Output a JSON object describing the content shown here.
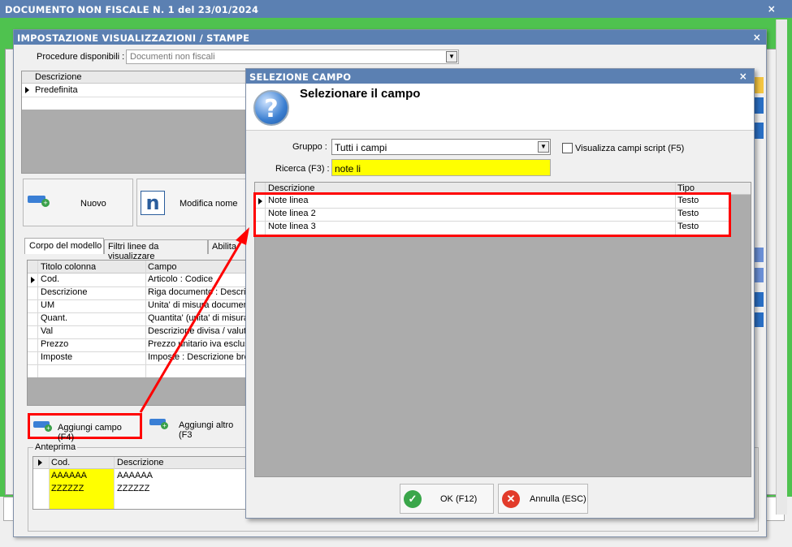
{
  "main_window": {
    "title": "DOCUMENTO NON FISCALE N. 1 del 23/01/2024",
    "close": "×"
  },
  "settings_dialog": {
    "title": "IMPOSTAZIONE VISUALIZZAZIONI / STAMPE",
    "close": "×",
    "procedure_label": "Procedure disponibili :",
    "procedure_value": "Documenti non fiscali",
    "models_header": "Descrizione",
    "models_row": "Predefinita",
    "btn_new": "Nuovo",
    "btn_rename": "Modifica nome",
    "tabs": [
      "Corpo del modello",
      "Filtri linee da visualizzare",
      "Abilita"
    ],
    "columns_headers": [
      "Titolo colonna",
      "Campo"
    ],
    "columns_rows": [
      [
        "Cod.",
        "Articolo : Codice"
      ],
      [
        "Descrizione",
        "Riga documento : Descriz"
      ],
      [
        "UM",
        "Unita' di misura documen"
      ],
      [
        "Quant.",
        "Quantita' (unita' di misura"
      ],
      [
        "Val",
        "Descrizione divisa / valut"
      ],
      [
        "Prezzo",
        "Prezzo unitario iva esclus"
      ],
      [
        "Imposte",
        "Imposte : Descrizione bre"
      ]
    ],
    "btn_add_field": "Aggiungi campo (F4)",
    "btn_add_other": "Aggiungi altro (F3",
    "preview_label": "Anteprima",
    "preview_headers": [
      "Cod.",
      "Descrizione"
    ],
    "preview_rows": [
      [
        "AAAAAA",
        "AAAAAA"
      ],
      [
        "ZZZZZZ",
        "ZZZZZZ"
      ]
    ]
  },
  "select_dialog": {
    "title": "SELEZIONE CAMPO",
    "close": "×",
    "heading": "Selezionare il campo",
    "group_label": "Gruppo :",
    "group_value": "Tutti i campi",
    "script_checkbox": "Visualizza campi script (F5)",
    "search_label": "Ricerca (F3) :",
    "search_value": "note li",
    "grid_headers": [
      "Descrizione",
      "Tipo"
    ],
    "grid_rows": [
      [
        "Note linea",
        "Testo"
      ],
      [
        "Note linea 2",
        "Testo"
      ],
      [
        "Note linea 3",
        "Testo"
      ]
    ],
    "btn_ok": "OK (F12)",
    "btn_cancel": "Annulla (ESC)"
  },
  "colors": {
    "title_bar": "#5b80b2",
    "highlight": "#ff0000",
    "yellow": "#ffff00",
    "green": "#4fc24f"
  }
}
